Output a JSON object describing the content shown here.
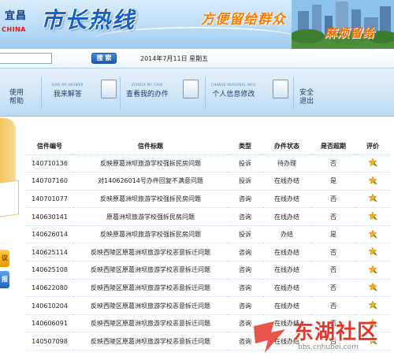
{
  "banner": {
    "city_name": "宜昌",
    "china": "CHINA",
    "site_title": "市长热线",
    "slogan_1": "方便留给群众",
    "slogan_2": "麻烦留给"
  },
  "search": {
    "value": "",
    "button_label": "搜 索",
    "date": "2014年7月11日  星期五"
  },
  "nav": {
    "help": "使用\n帮助",
    "help_line1": "使用",
    "help_line2": "帮助",
    "answer_en": "GIVE MY ANSWER",
    "answer": "我来解答",
    "case_en": "ECHECK MY CASE",
    "case": "查看我的办件",
    "info_en": "CHANGE PERSONAL INFO",
    "info": "个人信息修改",
    "logout_line1": "安全",
    "logout_line2": "退出"
  },
  "sidebar": {
    "btn1": "议",
    "btn2": "报"
  },
  "table": {
    "headers": [
      "信件编号",
      "信件标题",
      "类型",
      "办件状态",
      "是否超期",
      "评价"
    ],
    "rows": [
      {
        "id": "140710136",
        "title": "反映原葛洲坝旅游学校强拆民房问题",
        "type": "投诉",
        "status": "待办理",
        "overdue": "否"
      },
      {
        "id": "140707160",
        "title": "对140626014号办件回复不满意问题",
        "type": "投诉",
        "status": "在线办结",
        "overdue": "是"
      },
      {
        "id": "140701077",
        "title": "反映原葛洲坝旅游学校强拆民房问题",
        "type": "咨询",
        "status": "在线办结",
        "overdue": "否"
      },
      {
        "id": "140630141",
        "title": "原葛洲坝旅游学校强拆民房问题",
        "type": "咨询",
        "status": "在线办结",
        "overdue": "否"
      },
      {
        "id": "140626014",
        "title": "反映原葛洲坝旅游学校强拆民房问题",
        "type": "投诉",
        "status": "办结",
        "overdue": "是"
      },
      {
        "id": "140625114",
        "title": "反映西陵区原葛洲坝旅游学校恶意拆迁问题",
        "type": "咨询",
        "status": "在线办结",
        "overdue": "否"
      },
      {
        "id": "140625108",
        "title": "反映西陵区原葛洲坝旅游学校恶意拆迁问题",
        "type": "咨询",
        "status": "在线办结",
        "overdue": "否"
      },
      {
        "id": "140622080",
        "title": "反映西陵区原葛洲坝旅游学校恶意拆迁问题",
        "type": "咨询",
        "status": "在线办结",
        "overdue": "否"
      },
      {
        "id": "140610204",
        "title": "反映西陵区原葛洲坝旅游学校恶意拆迁问题",
        "type": "咨询",
        "status": "在线办结",
        "overdue": "否"
      },
      {
        "id": "140606091",
        "title": "反映西陵区原葛洲坝旅游学校恶意拆迁问题",
        "type": "咨询",
        "status": "在线办结",
        "overdue": "否"
      },
      {
        "id": "140507098",
        "title": "反映西陵区原葛洲坝旅游学校恶意拆迁问题",
        "type": "咨询",
        "status": "在线办结",
        "overdue": "否"
      }
    ]
  },
  "watermark": {
    "name": "东湖社区",
    "url": "bbs.cnhubei.com"
  },
  "colors": {
    "brand_blue": "#1560c6",
    "slogan_orange": "#ff7a00",
    "star_gold": "#f2b21b",
    "watermark_red": "#e5362b"
  }
}
